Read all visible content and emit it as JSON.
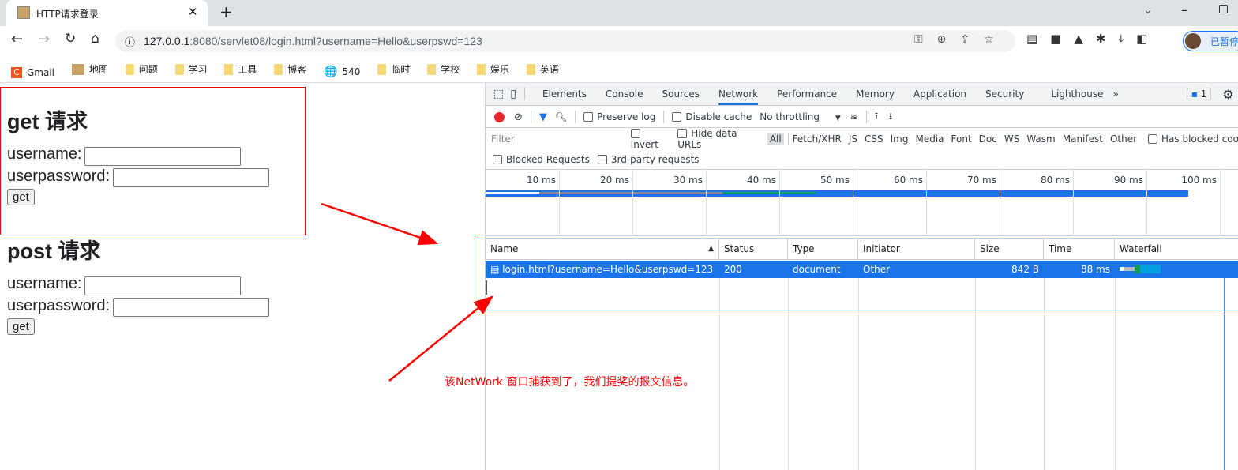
{
  "browser": {
    "tab_title": "HTTP请求登录",
    "url_host": "127.0.0.1",
    "url_rest": ":8080/servlet08/login.html?username=Hello&userpswd=123",
    "profile_label": "已暂停",
    "bookmarks": [
      "Gmail",
      "地图",
      "问题",
      "学习",
      "工具",
      "博客",
      "540",
      "临时",
      "学校",
      "娱乐",
      "英语"
    ]
  },
  "page": {
    "get_title": "get 请求",
    "post_title": "post 请求",
    "username_label": "username:",
    "password_label": "userpassword:",
    "button_label": "get"
  },
  "devtools": {
    "tabs": [
      "Elements",
      "Console",
      "Sources",
      "Network",
      "Performance",
      "Memory",
      "Application",
      "Security",
      "Lighthouse"
    ],
    "active_tab": "Network",
    "issues_count": "1",
    "toolbar": {
      "preserve_log": "Preserve log",
      "disable_cache": "Disable cache",
      "throttling": "No throttling"
    },
    "filter": {
      "placeholder": "Filter",
      "invert": "Invert",
      "hide_data_urls": "Hide data URLs",
      "types": [
        "All",
        "Fetch/XHR",
        "JS",
        "CSS",
        "Img",
        "Media",
        "Font",
        "Doc",
        "WS",
        "Wasm",
        "Manifest",
        "Other"
      ],
      "has_blocked": "Has blocked coo",
      "blocked_requests": "Blocked Requests",
      "third_party": "3rd-party requests"
    },
    "timeline_ticks": [
      "10 ms",
      "20 ms",
      "30 ms",
      "40 ms",
      "50 ms",
      "60 ms",
      "70 ms",
      "80 ms",
      "90 ms",
      "100 ms"
    ],
    "columns": [
      "Name",
      "Status",
      "Type",
      "Initiator",
      "Size",
      "Time",
      "Waterfall"
    ],
    "rows": [
      {
        "name": "login.html?username=Hello&userpswd=123",
        "status": "200",
        "type": "document",
        "initiator": "Other",
        "size": "842 B",
        "time": "88 ms"
      }
    ]
  },
  "annotation": "该NetWork 窗口捕获到了，我们提奖的报文信息。"
}
